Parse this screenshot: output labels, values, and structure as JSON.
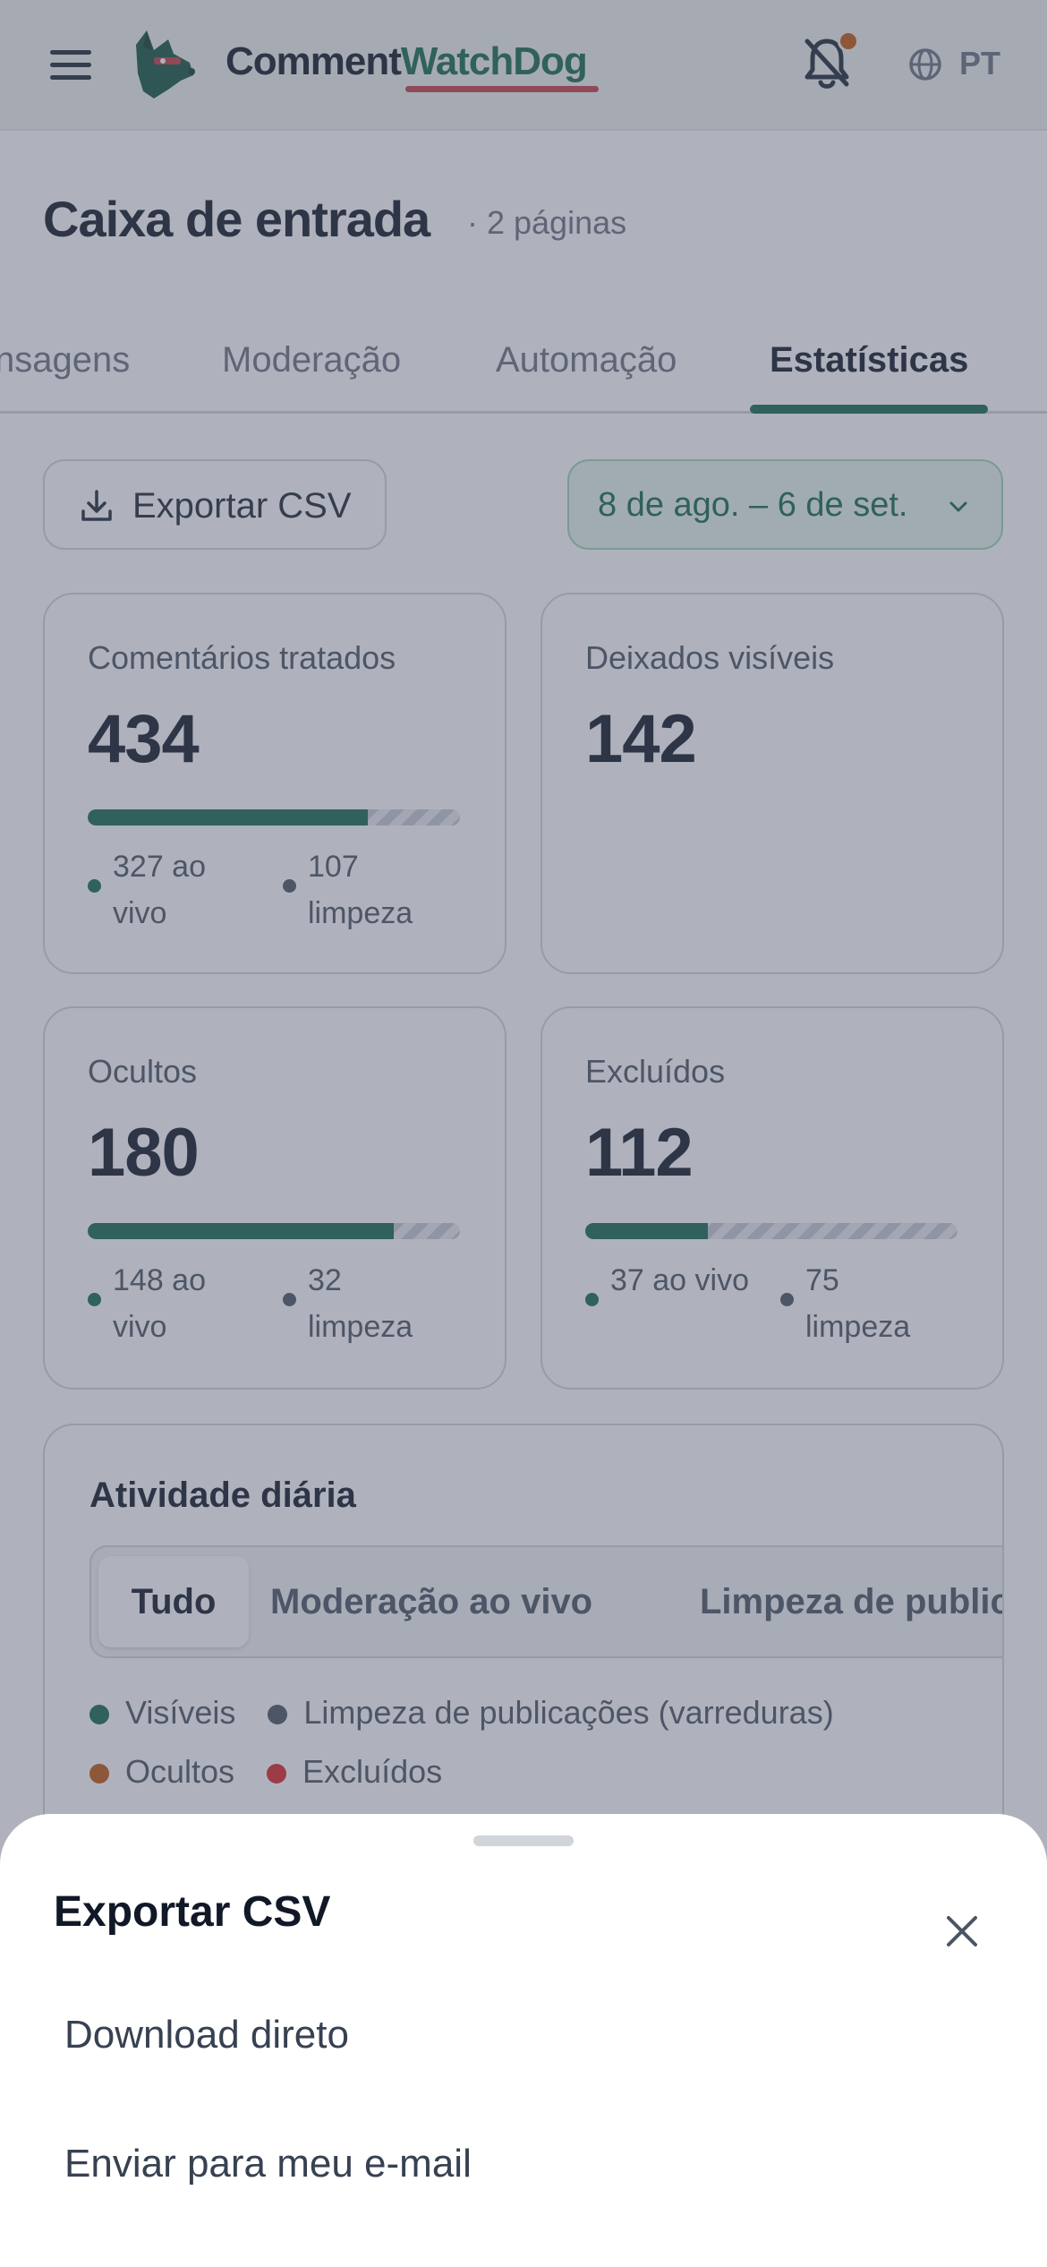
{
  "header": {
    "brand_part1": "Comment",
    "brand_part2": "WatchDog",
    "language": "PT",
    "icons": [
      "menu-icon",
      "dog-logo-icon",
      "bell-icon",
      "globe-icon"
    ],
    "brand_color": "#166a4f",
    "underline_color": "#c43d45",
    "notification_color": "#c2580e"
  },
  "page": {
    "title": "Caixa de entrada",
    "subtitle": "· 2 páginas"
  },
  "tabs": [
    {
      "label": "nsagens",
      "active": false
    },
    {
      "label": "Moderação",
      "active": false
    },
    {
      "label": "Automação",
      "active": false
    },
    {
      "label": "Estatísticas",
      "active": true
    }
  ],
  "toolbar": {
    "export_label": "Exportar CSV",
    "date_range": "8 de ago. – 6 de set."
  },
  "stats": [
    {
      "label": "Comentários tratados",
      "value": "434",
      "live_fraction": 0.753,
      "live": "327 ao vivo",
      "cleanup": "107 limpeza"
    },
    {
      "label": "Deixados visíveis",
      "value": "142"
    },
    {
      "label": "Ocultos",
      "value": "180",
      "live_fraction": 0.822,
      "live": "148 ao vivo",
      "cleanup": "32 limpeza"
    },
    {
      "label": "Excluídos",
      "value": "112",
      "live_fraction": 0.33,
      "live": "37 ao vivo",
      "cleanup": "75 limpeza"
    }
  ],
  "activity": {
    "title": "Atividade diária",
    "segments": [
      "Tudo",
      "Moderação ao vivo",
      "Limpeza de publicações"
    ],
    "active_segment": "Tudo",
    "legend": [
      {
        "label": "Visíveis",
        "color": "#166a4f"
      },
      {
        "label": "Limpeza de publicações (varreduras)",
        "color": "#4b5563"
      },
      {
        "label": "Ocultos",
        "color": "#c2580e"
      },
      {
        "label": "Excluídos",
        "color": "#dc2626"
      }
    ]
  },
  "sheet": {
    "title": "Exportar CSV",
    "options": [
      "Download direto",
      "Enviar para meu e-mail"
    ]
  }
}
